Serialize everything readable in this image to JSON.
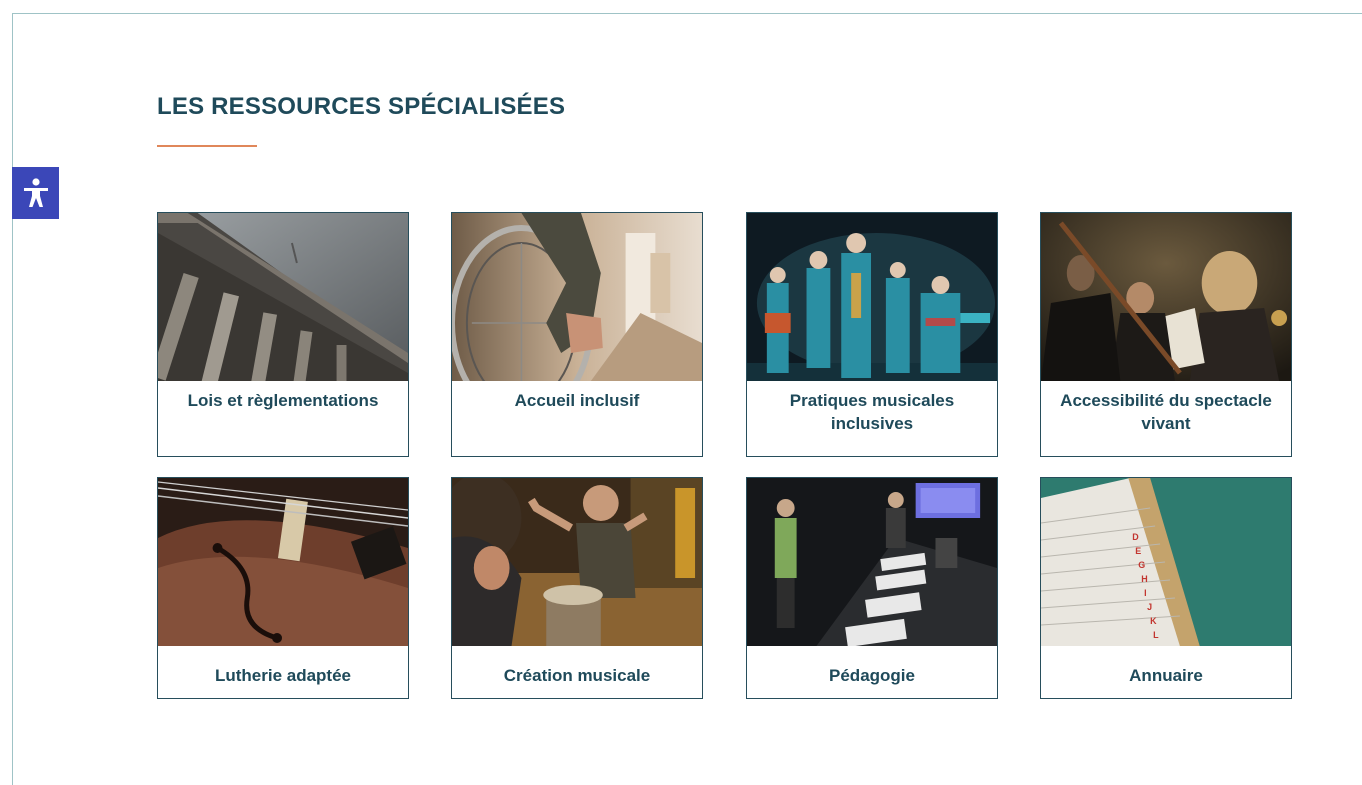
{
  "section": {
    "title": "LES RESSOURCES SPÉCIALISÉES"
  },
  "accessibility": {
    "icon": "accessibility-person-icon",
    "color": "#3b47b8"
  },
  "accent_colors": {
    "title": "#1f4a5a",
    "underline": "#e0875a",
    "card_border": "#274e5c"
  },
  "cards": [
    {
      "label": "Lois et règlementations",
      "image": "courthouse-columns-image"
    },
    {
      "label": "Accueil inclusif",
      "image": "wheelchair-hallway-image"
    },
    {
      "label": "Pratiques musicales inclusives",
      "image": "stage-performers-image"
    },
    {
      "label": "Accessibilité du spectacle vivant",
      "image": "orchestra-musicians-image"
    },
    {
      "label": "Lutherie adaptée",
      "image": "violin-closeup-image"
    },
    {
      "label": "Création musicale",
      "image": "child-drum-image"
    },
    {
      "label": "Pédagogie",
      "image": "classroom-workshop-image"
    },
    {
      "label": "Annuaire",
      "image": "index-cards-directory-image"
    }
  ]
}
